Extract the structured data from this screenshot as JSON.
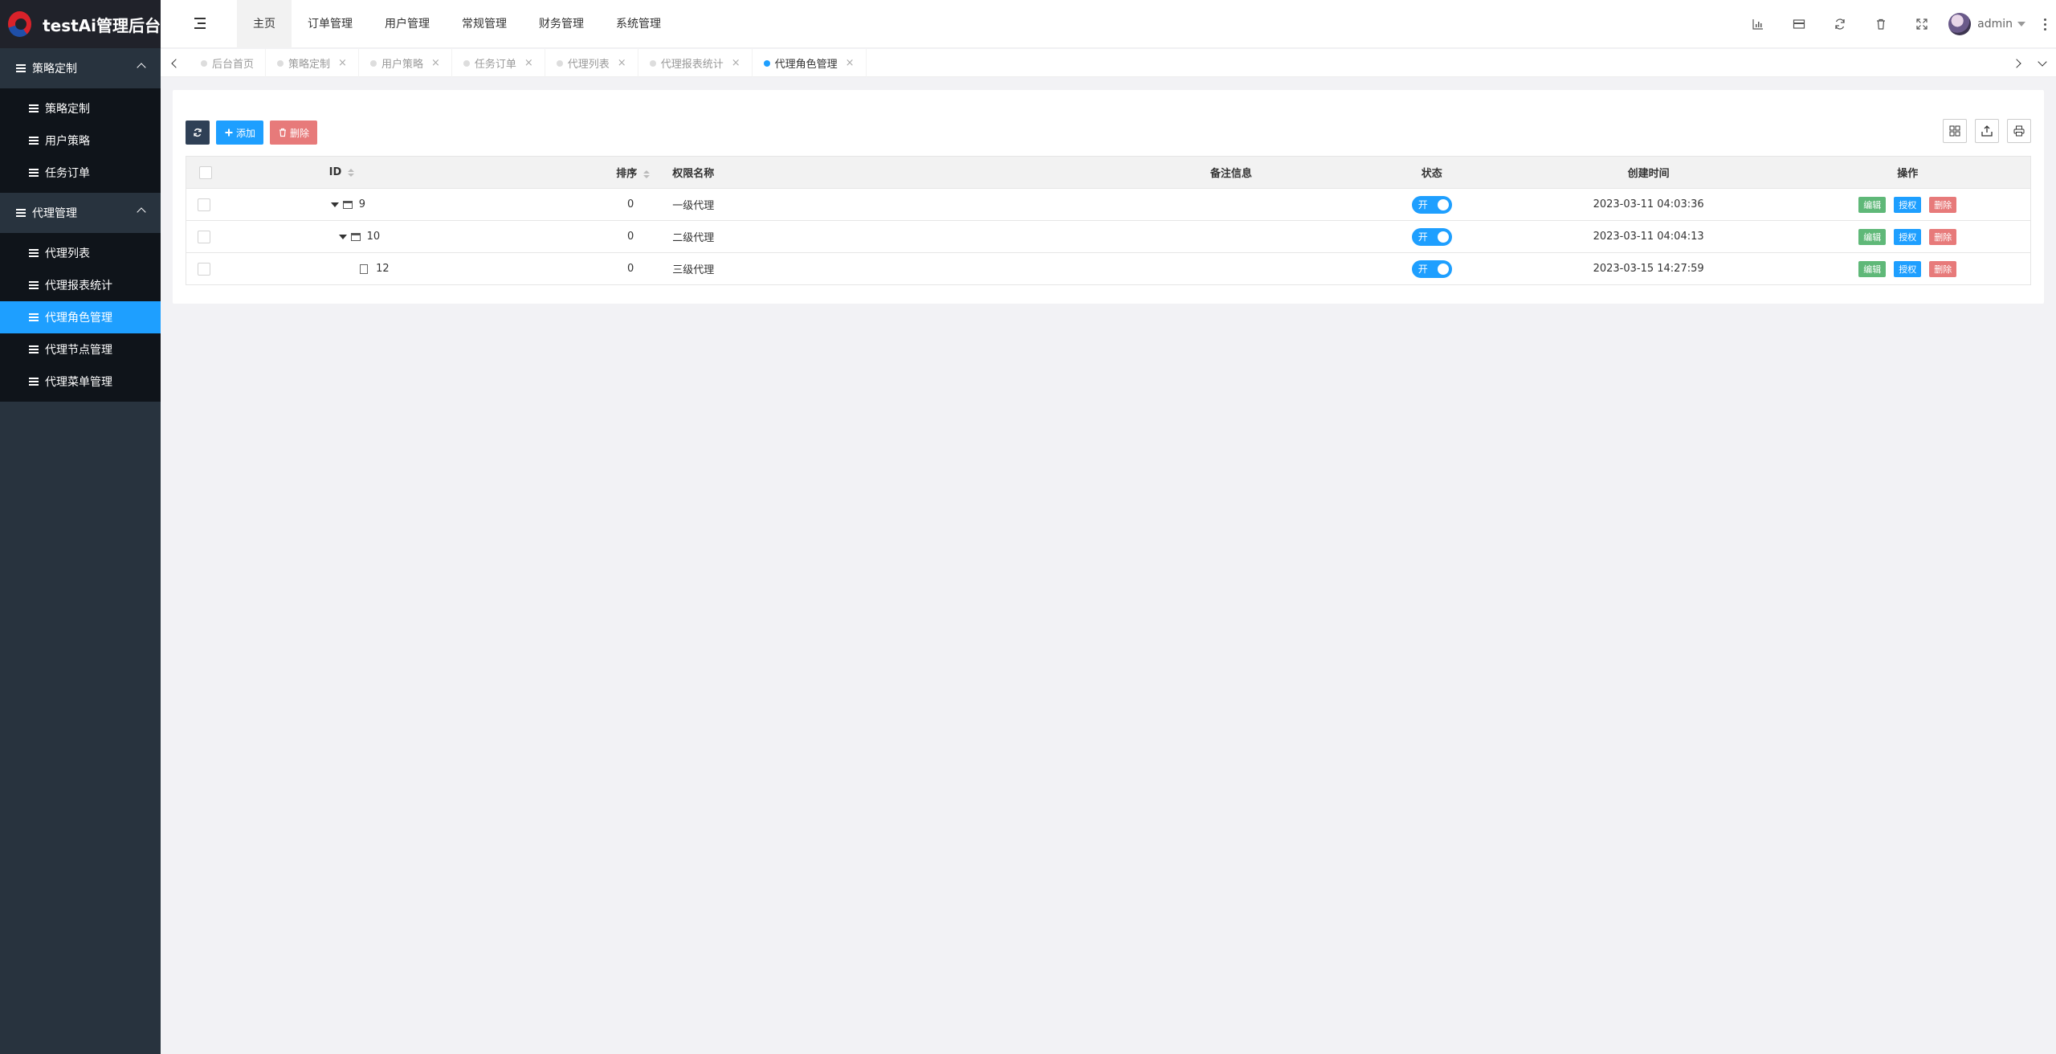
{
  "app": {
    "title": "testAi管理后台"
  },
  "sidebar": {
    "groups": [
      {
        "label": "策略定制",
        "items": [
          "策略定制",
          "用户策略",
          "任务订单"
        ]
      },
      {
        "label": "代理管理",
        "items": [
          "代理列表",
          "代理报表统计",
          "代理角色管理",
          "代理节点管理",
          "代理菜单管理"
        ]
      }
    ],
    "active_item": "代理角色管理"
  },
  "topnav": {
    "items": [
      "主页",
      "订单管理",
      "用户管理",
      "常规管理",
      "财务管理",
      "系统管理"
    ],
    "active": "主页"
  },
  "header": {
    "user_name": "admin"
  },
  "tabs": {
    "items": [
      "后台首页",
      "策略定制",
      "用户策略",
      "任务订单",
      "代理列表",
      "代理报表统计",
      "代理角色管理"
    ],
    "active": "代理角色管理"
  },
  "toolbar": {
    "add_label": "添加",
    "delete_label": "删除"
  },
  "table": {
    "headers": {
      "id": "ID",
      "sort": "排序",
      "name": "权限名称",
      "remark": "备注信息",
      "status": "状态",
      "created": "创建时间",
      "ops": "操作"
    },
    "rows": [
      {
        "id": "9",
        "sort": "0",
        "name": "一级代理",
        "remark": "",
        "status": "开",
        "created": "2023-03-11 04:03:36"
      },
      {
        "id": "10",
        "sort": "0",
        "name": "二级代理",
        "remark": "",
        "status": "开",
        "created": "2023-03-11 04:04:13"
      },
      {
        "id": "12",
        "sort": "0",
        "name": "三级代理",
        "remark": "",
        "status": "开",
        "created": "2023-03-15 14:27:59"
      }
    ],
    "op_labels": {
      "edit": "编辑",
      "auth": "授权",
      "delete": "删除"
    }
  },
  "colors": {
    "accent": "#1e9fff",
    "sidebar_bg": "#28333e",
    "submenu_bg": "#0f141a",
    "edit": "#5fb878",
    "danger": "#e77a7a"
  }
}
